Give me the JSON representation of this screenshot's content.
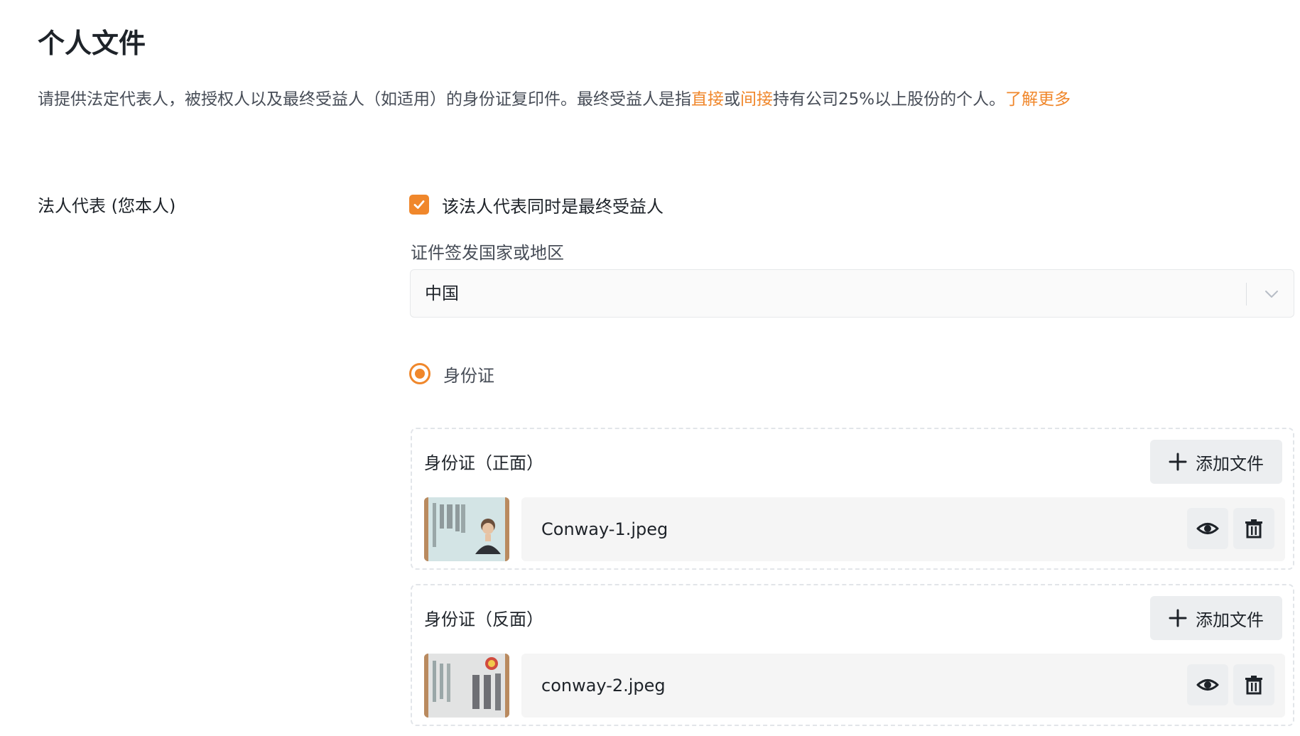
{
  "page": {
    "title": "个人文件",
    "description": {
      "part1": "请提供法定代表人，被授权人以及最终受益人（如适用）的身份证复印件。最终受益人是指",
      "direct": "直接",
      "or": "或",
      "indirect": "间接",
      "part2": "持有公司25%以上股份的个人。",
      "learn_more": "了解更多"
    }
  },
  "legal_rep": {
    "section_label": "法人代表 (您本人)",
    "checkbox_label": "该法人代表同时是最终受益人",
    "checkbox_checked": true,
    "country_label": "证件签发国家或地区",
    "country_value": "中国",
    "id_type_label": "身份证",
    "id_type_selected": true
  },
  "uploads": [
    {
      "title": "身份证（正面）",
      "add_label": "添加文件",
      "file_name": "Conway-1.jpeg"
    },
    {
      "title": "身份证（反面）",
      "add_label": "添加文件",
      "file_name": "conway-2.jpeg"
    }
  ],
  "colors": {
    "accent": "#f0872b",
    "text_primary": "#1e2329",
    "text_secondary": "#474d57",
    "button_bg": "#eceef0"
  }
}
